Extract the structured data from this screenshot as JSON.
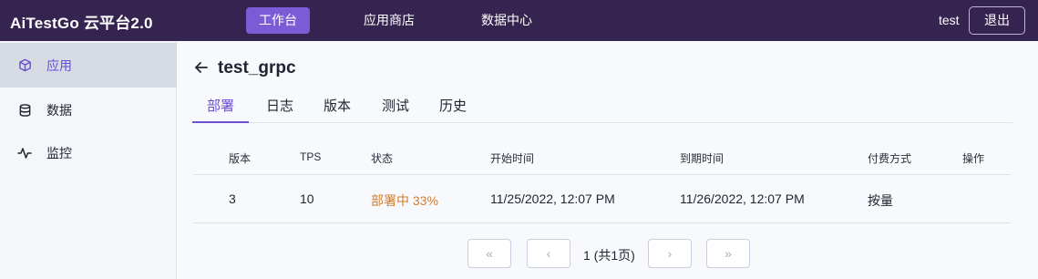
{
  "header": {
    "brand": "AiTestGo 云平台2.0",
    "nav": [
      "工作台",
      "应用商店",
      "数据中心"
    ],
    "username": "test",
    "logout": "退出"
  },
  "sidebar": {
    "items": [
      {
        "label": "应用",
        "icon": "cube-icon"
      },
      {
        "label": "数据",
        "icon": "database-icon"
      },
      {
        "label": "监控",
        "icon": "pulse-icon"
      }
    ]
  },
  "page": {
    "title": "test_grpc",
    "tabs": [
      "部署",
      "日志",
      "版本",
      "测试",
      "历史"
    ]
  },
  "table": {
    "headers": [
      "版本",
      "TPS",
      "状态",
      "开始时间",
      "到期时间",
      "付费方式",
      "操作"
    ],
    "rows": [
      {
        "version": "3",
        "tps": "10",
        "status": "部署中 33%",
        "start": "11/25/2022, 12:07 PM",
        "end": "11/26/2022, 12:07 PM",
        "billing": "按量",
        "actions": ""
      }
    ]
  },
  "pagination": {
    "first": "«",
    "prev": "‹",
    "info": "1 (共1页)",
    "next": "›",
    "last": "»"
  },
  "colors": {
    "topbar": "#34244f",
    "accent": "#7b5cd6",
    "status": "#d27d2d"
  }
}
